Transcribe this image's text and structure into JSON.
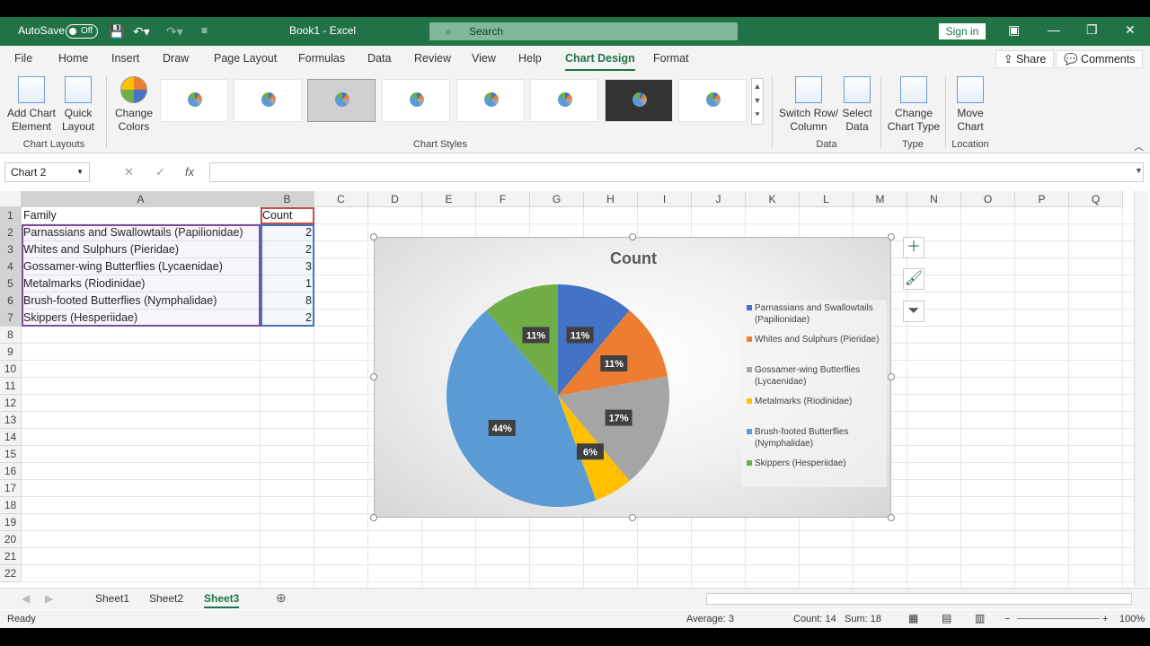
{
  "titlebar": {
    "autosave_label": "AutoSave",
    "autosave_state": "Off",
    "doc_title": "Book1  -  Excel",
    "search_placeholder": "Search",
    "sign_in": "Sign in"
  },
  "menu": {
    "tabs": [
      "File",
      "Home",
      "Insert",
      "Draw",
      "Page Layout",
      "Formulas",
      "Data",
      "Review",
      "View",
      "Help",
      "Chart Design",
      "Format"
    ],
    "active": "Chart Design",
    "share": "Share",
    "comments": "Comments"
  },
  "ribbon": {
    "add_chart_element": [
      "Add Chart",
      "Element"
    ],
    "quick_layout": [
      "Quick",
      "Layout"
    ],
    "change_colors": [
      "Change",
      "Colors"
    ],
    "switch_row_col": [
      "Switch Row/",
      "Column"
    ],
    "select_data": [
      "Select",
      "Data"
    ],
    "change_chart_type": [
      "Change",
      "Chart Type"
    ],
    "move_chart": [
      "Move",
      "Chart"
    ],
    "groups": {
      "chart_layouts": "Chart Layouts",
      "chart_styles": "Chart Styles",
      "data": "Data",
      "type": "Type",
      "location": "Location"
    }
  },
  "formula_bar": {
    "name_box": "Chart 2",
    "fx": "fx",
    "value": ""
  },
  "sheet": {
    "columns": [
      "A",
      "B",
      "C",
      "D",
      "E",
      "F",
      "G",
      "H",
      "I",
      "J",
      "K",
      "L",
      "M",
      "N",
      "O",
      "P",
      "Q"
    ],
    "rows": [
      "1",
      "2",
      "3",
      "4",
      "5",
      "6",
      "7",
      "8",
      "9",
      "10",
      "11",
      "12",
      "13",
      "14",
      "15",
      "16",
      "17",
      "18",
      "19",
      "20",
      "21",
      "22"
    ],
    "header": [
      "Family",
      "Count"
    ],
    "data": [
      [
        "Parnassians and Swallowtails (Papilionidae)",
        "2"
      ],
      [
        "Whites and Sulphurs (Pieridae)",
        "2"
      ],
      [
        "Gossamer-wing Butterflies (Lycaenidae)",
        "3"
      ],
      [
        "Metalmarks (Riodinidae)",
        "1"
      ],
      [
        "Brush-footed Butterflies (Nymphalidae)",
        "8"
      ],
      [
        "Skippers (Hesperiidae)",
        "2"
      ]
    ]
  },
  "chart_data": {
    "type": "pie",
    "title": "Count",
    "categories": [
      "Parnassians and Swallowtails (Papilionidae)",
      "Whites and Sulphurs (Pieridae)",
      "Gossamer-wing Butterflies (Lycaenidae)",
      "Metalmarks (Riodinidae)",
      "Brush-footed Butterflies (Nymphalidae)",
      "Skippers (Hesperiidae)"
    ],
    "legend_lines": [
      [
        "Parnassians and Swallowtails",
        "(Papilionidae)"
      ],
      [
        "Whites and Sulphurs (Pieridae)"
      ],
      [
        "Gossamer-wing Butterflies",
        "(Lycaenidae)"
      ],
      [
        "Metalmarks (Riodinidae)"
      ],
      [
        "Brush-footed Butterflies",
        "(Nymphalidae)"
      ],
      [
        "Skippers (Hesperiidae)"
      ]
    ],
    "values": [
      2,
      2,
      3,
      1,
      8,
      2
    ],
    "data_labels": [
      "11%",
      "11%",
      "17%",
      "6%",
      "44%",
      "11%"
    ],
    "colors": [
      "#4472c4",
      "#ed7d31",
      "#a5a5a5",
      "#ffc000",
      "#5b9bd5",
      "#70ad47"
    ],
    "legend_position": "right"
  },
  "sheet_tabs": [
    "Sheet1",
    "Sheet2",
    "Sheet3"
  ],
  "active_sheet": "Sheet3",
  "status": {
    "ready": "Ready",
    "average": "Average: 3",
    "count": "Count: 14",
    "sum": "Sum: 18",
    "zoom": "100%"
  }
}
